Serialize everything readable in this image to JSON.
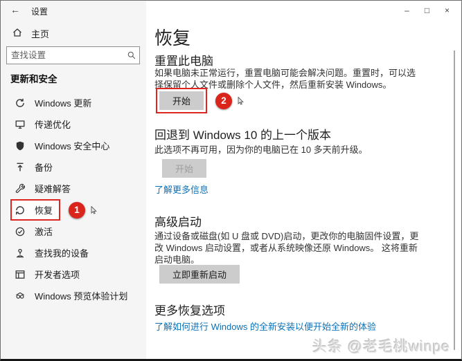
{
  "titlebar": {
    "back_icon": "←",
    "title": "设置",
    "controls": {
      "minimize": "–",
      "maximize": "□",
      "close": "×"
    }
  },
  "sidebar": {
    "home_label": "主页",
    "search_placeholder": "查找设置",
    "section_header": "更新和安全",
    "items": [
      {
        "label": "Windows 更新",
        "icon": "windows-update-icon"
      },
      {
        "label": "传递优化",
        "icon": "delivery-optimization-icon"
      },
      {
        "label": "Windows 安全中心",
        "icon": "windows-security-shield-icon"
      },
      {
        "label": "备份",
        "icon": "backup-icon"
      },
      {
        "label": "疑难解答",
        "icon": "troubleshoot-wrench-icon"
      },
      {
        "label": "恢复",
        "icon": "recovery-icon",
        "selected": true,
        "annotation": "1"
      },
      {
        "label": "激活",
        "icon": "activation-check-icon"
      },
      {
        "label": "查找我的设备",
        "icon": "find-my-device-icon"
      },
      {
        "label": "开发者选项",
        "icon": "developer-options-icon"
      },
      {
        "label": "Windows 预览体验计划",
        "icon": "windows-insider-icon"
      }
    ]
  },
  "main": {
    "page_title": "恢复",
    "reset": {
      "heading": "重置此电脑",
      "description": "如果电脑未正常运行，重置电脑可能会解决问题。重置时，可以选\n择保留个人文件或删除个人文件，然后重新安装 Windows。",
      "button": "开始",
      "annotation": "2"
    },
    "go_back": {
      "heading": "回退到 Windows 10 的上一个版本",
      "description": "此选项不再可用，因为你的电脑已在 10 多天前升级。",
      "button": "开始",
      "link": "了解更多信息"
    },
    "advanced": {
      "heading": "高级启动",
      "description": "通过设备或磁盘(如 U 盘或 DVD)启动，更改你的电脑固件设置，更\n改 Windows 启动设置，或者从系统映像还原 Windows。 这将重新\n启动电脑。",
      "button": "立即重新启动"
    },
    "more": {
      "heading": "更多恢复选项",
      "link": "了解如何进行 Windows 的全新安装以便开始全新的体验"
    }
  },
  "watermark": "头条 @老毛桃winpe",
  "colors": {
    "accent_link": "#0b72b9",
    "annotation_red": "#dd2620",
    "button_bg": "#cccccc"
  }
}
